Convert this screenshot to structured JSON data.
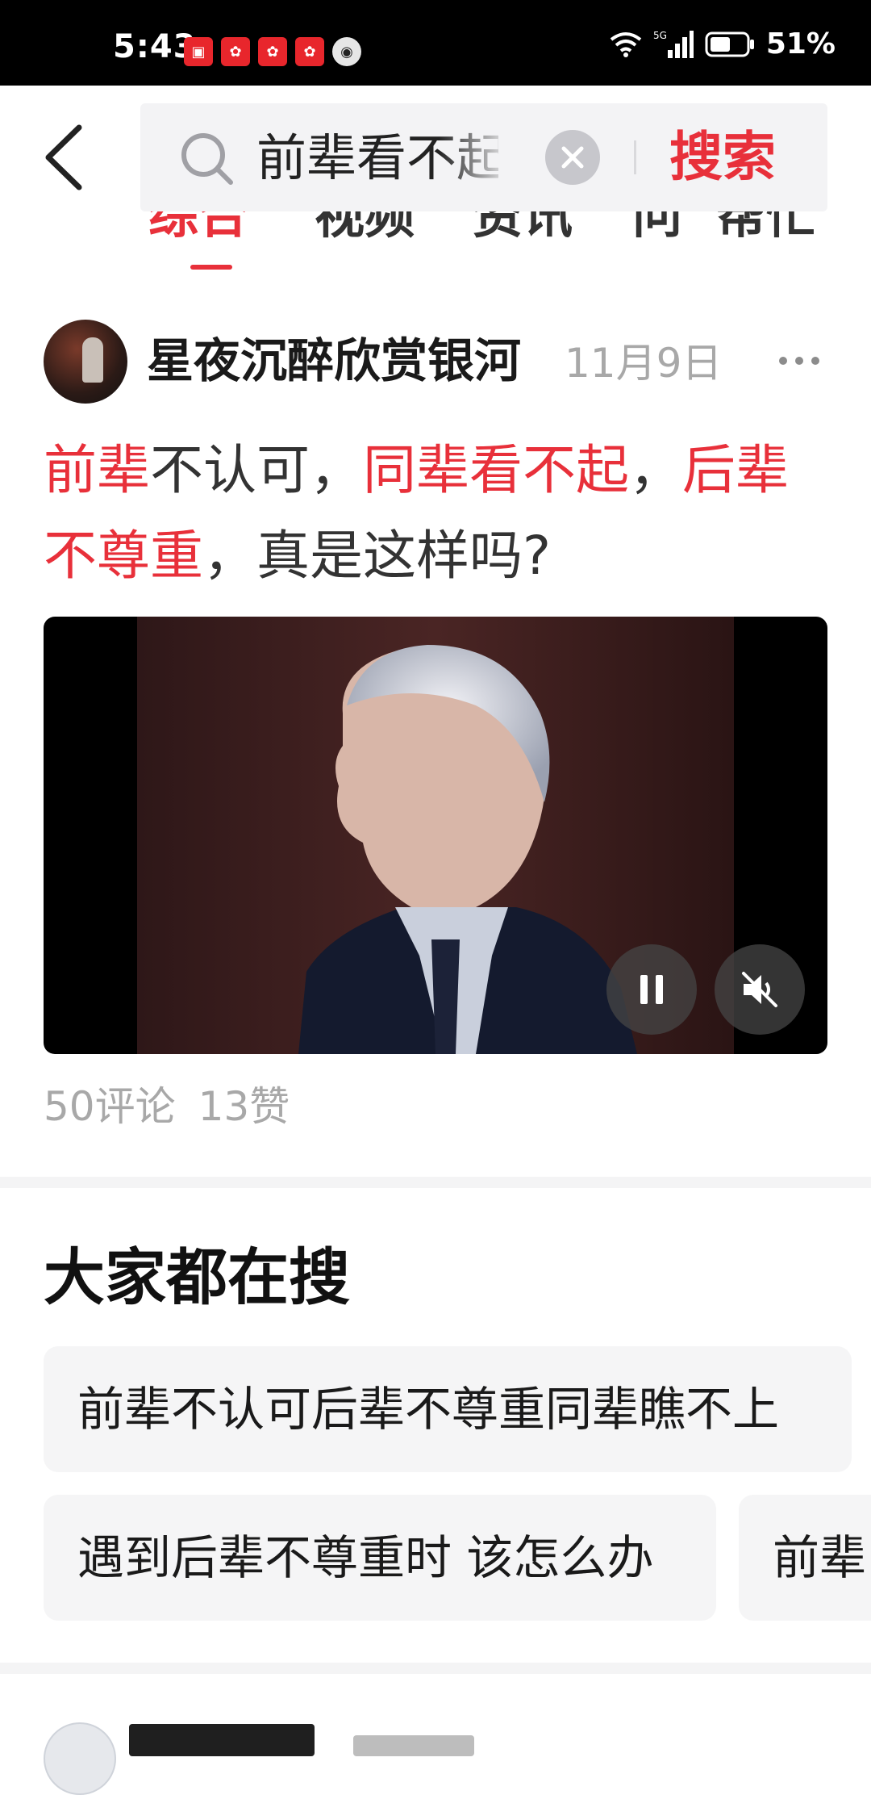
{
  "status_bar": {
    "time": "5:43",
    "battery": "51%",
    "network": "5G"
  },
  "search": {
    "query": "前辈看不起",
    "button_label": "搜索"
  },
  "tabs": [
    {
      "label": "综合",
      "active": true
    },
    {
      "label": "视频",
      "active": false
    },
    {
      "label": "资讯",
      "active": false
    },
    {
      "label": "问",
      "active": false
    },
    {
      "label": "帮忙",
      "active": false
    }
  ],
  "post": {
    "author": "星夜沉醉欣赏银河",
    "date": "11月9日",
    "title_segments": [
      {
        "text": "前辈",
        "highlight": true
      },
      {
        "text": "不认可，",
        "highlight": false
      },
      {
        "text": "同辈看不起",
        "highlight": true
      },
      {
        "text": "，",
        "highlight": false
      },
      {
        "text": "后辈不尊重",
        "highlight": true
      },
      {
        "text": "，真是这样吗?",
        "highlight": false
      }
    ],
    "comments": "50评论",
    "likes": "13赞"
  },
  "hot_searches": {
    "title": "大家都在搜",
    "items": [
      "前辈不认可后辈不尊重同辈瞧不上",
      "遇到后辈不尊重时 该怎么办",
      "前辈"
    ]
  },
  "colors": {
    "accent": "#e8303a",
    "muted_text": "#a8a8a8",
    "chip_bg": "#f5f5f6"
  }
}
